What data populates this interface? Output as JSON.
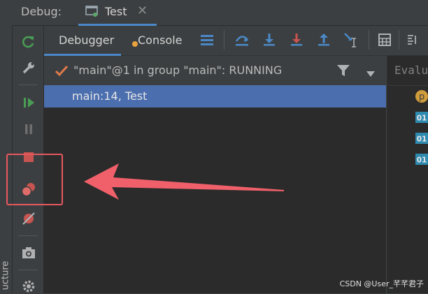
{
  "titlebar": {
    "debug_label": "Debug:",
    "tab_label": "Test",
    "tab_close": "✕"
  },
  "structure": {
    "label": "ucture"
  },
  "subbar": {
    "tab_debugger": "Debugger",
    "tab_console": "Console"
  },
  "frames": {
    "thread_label": "\"main\"@1 in group \"main\": RUNNING",
    "selected_frame": "main:14, Test"
  },
  "vars": {
    "eval_placeholder": "Evalu",
    "icons": [
      "p",
      "01",
      "01",
      "01"
    ]
  },
  "watermark": "CSDN @User_芊芊君子",
  "colors": {
    "accent": "#4a88c7",
    "selection": "#4b6eaf",
    "highlight": "#e8585f",
    "resume_green": "#499c54",
    "stop_red": "#c75450"
  }
}
